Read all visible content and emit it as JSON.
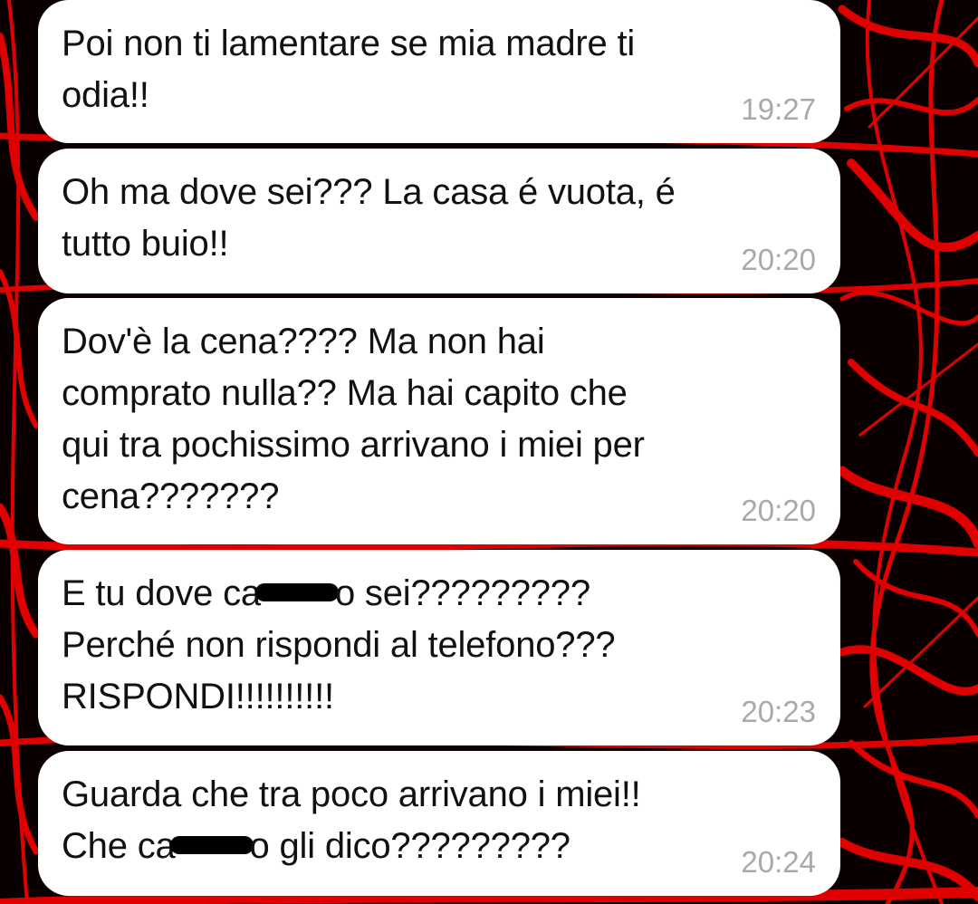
{
  "colors": {
    "wallpaper_base": "#0a0000",
    "wallpaper_lines": "#e00000",
    "bubble": "#ffffff",
    "text": "#111111",
    "timestamp": "#a9a9a9",
    "censor_bar": "#000000"
  },
  "messages": [
    {
      "text": "Poi non ti lamentare se mia madre ti\nodia!!",
      "time": "19:27"
    },
    {
      "text": "Oh ma dove sei??? La casa é vuota, é\ntutto buio!!",
      "time": "20:20"
    },
    {
      "text": "Dov'è la cena???? Ma non hai\ncomprato nulla?? Ma hai capito che\nqui tra pochissimo arrivano i miei per\ncena???????",
      "time": "20:20"
    },
    {
      "text_before_censor": "E tu dove ca",
      "text_after_censor": "o sei?????????\nPerché non rispondi al telefono???\nRISPONDI!!!!!!!!!!",
      "time": "20:23"
    },
    {
      "text_before_censor": "Guarda che tra poco arrivano i miei!!\nChe ca",
      "text_after_censor": "o gli dico?????????",
      "time": "20:24"
    }
  ]
}
